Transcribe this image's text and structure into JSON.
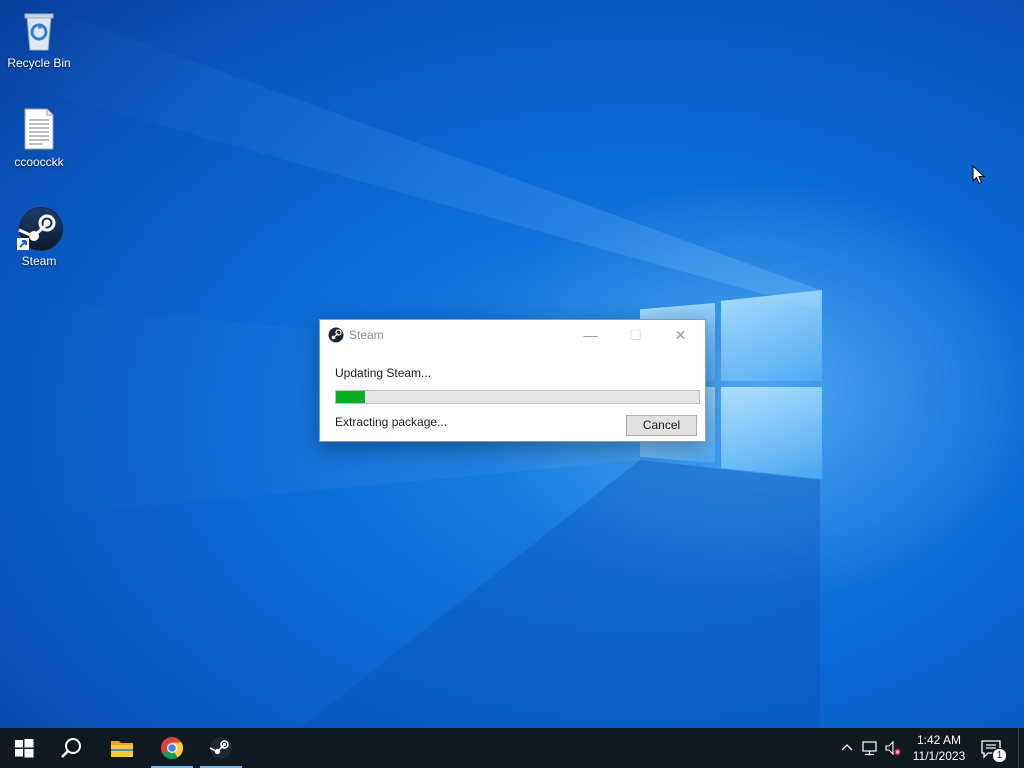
{
  "desktop": {
    "icons": [
      {
        "label": "Recycle Bin",
        "icon": "recycle-bin-icon"
      },
      {
        "label": "ccoocckk",
        "icon": "text-document-icon"
      },
      {
        "label": "Steam",
        "icon": "steam-shortcut-icon"
      }
    ]
  },
  "dialog": {
    "title": "Steam",
    "title_icon": "steam-icon",
    "status": "Updating Steam...",
    "progress": 0.08,
    "substatus": "Extracting package...",
    "cancel_label": "Cancel",
    "minimize_glyph": "—",
    "maximize_glyph": "☐",
    "close_glyph": "✕",
    "progress_color": "#06b025"
  },
  "taskbar": {
    "start_icon": "windows-start-icon",
    "search_icon": "search-icon",
    "pinned": [
      {
        "name": "file-explorer",
        "icon": "folder-icon",
        "active": false
      },
      {
        "name": "chrome",
        "icon": "chrome-icon",
        "active": true
      },
      {
        "name": "steam",
        "icon": "steam-icon",
        "active": true
      }
    ],
    "tray": {
      "chevron_icon": "chevron-up-icon",
      "network_icon": "network-icon",
      "volume_icon": "volume-muted-icon"
    },
    "clock": {
      "time": "1:42 AM",
      "date": "11/1/2023"
    },
    "notifications": {
      "count": "1",
      "icon": "action-center-icon"
    }
  },
  "colors": {
    "taskbar_bg": "#101820",
    "accent": "#76b9ed",
    "desktop_blue": "#0a6ad6"
  }
}
